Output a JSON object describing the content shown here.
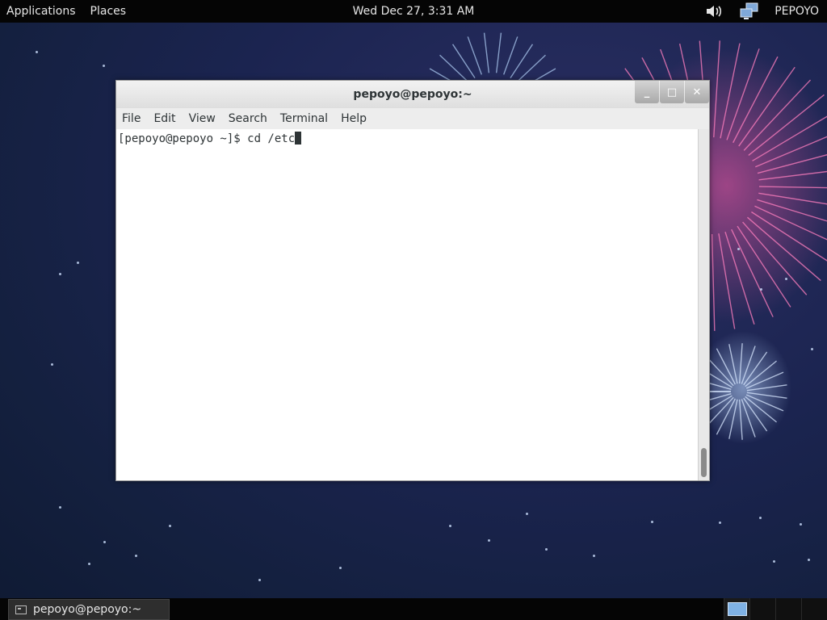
{
  "topbar": {
    "applications": "Applications",
    "places": "Places",
    "clock": "Wed Dec 27,  3:31 AM",
    "user": "PEPOYO",
    "volume_icon": "volume-icon",
    "network_icon": "network-icon"
  },
  "window": {
    "title": "pepoyo@pepoyo:~",
    "buttons": {
      "minimize": "_",
      "maximize": "□",
      "close": "✕"
    },
    "menu": [
      "File",
      "Edit",
      "View",
      "Search",
      "Terminal",
      "Help"
    ],
    "terminal_text": "[pepoyo@pepoyo ~]$ cd /etc"
  },
  "taskbar": {
    "task_label": "pepoyo@pepoyo:~",
    "workspace_count": 4,
    "active_workspace": 1
  },
  "colors": {
    "topbar_bg": "#050505",
    "desktop_bg": "#1b2450",
    "window_bg": "#ffffff",
    "workspace_active": "#7fb2e5"
  }
}
